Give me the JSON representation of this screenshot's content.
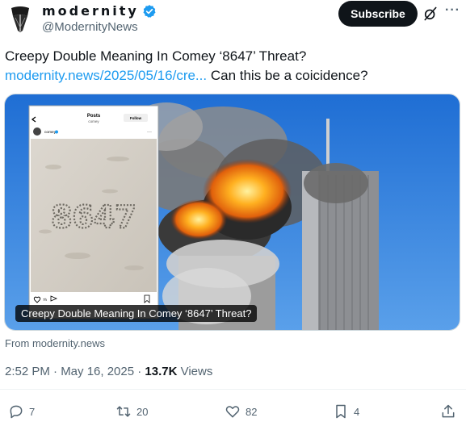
{
  "author": {
    "display_name": "modernity",
    "handle": "@ModernityNews"
  },
  "actions_top": {
    "subscribe_label": "Subscribe"
  },
  "tweet": {
    "text_line1": "Creepy Double Meaning In Comey ‘8647’ Threat?",
    "link": "modernity.news/2025/05/16/cre...",
    "text_after_link": "Can this be a coicidence?"
  },
  "media": {
    "caption": "Creepy Double Meaning In Comey ‘8647’ Threat?",
    "inset": {
      "header_title": "Posts",
      "header_sub": "comey",
      "follow_label": "Follow",
      "username": "comey",
      "sand_text": "8647",
      "like_count": "7h"
    }
  },
  "source": "From modernity.news",
  "meta": {
    "time_date": "2:52 PM · May 16, 2025 · ",
    "views_count": "13.7K",
    "views_label": " Views"
  },
  "engagement": {
    "replies": "7",
    "reposts": "20",
    "likes": "82",
    "bookmarks": "4"
  },
  "colors": {
    "link": "#1d9bf0",
    "verified": "#1d9bf0",
    "subscribe_bg": "#0f1419",
    "text_secondary": "#536471"
  }
}
